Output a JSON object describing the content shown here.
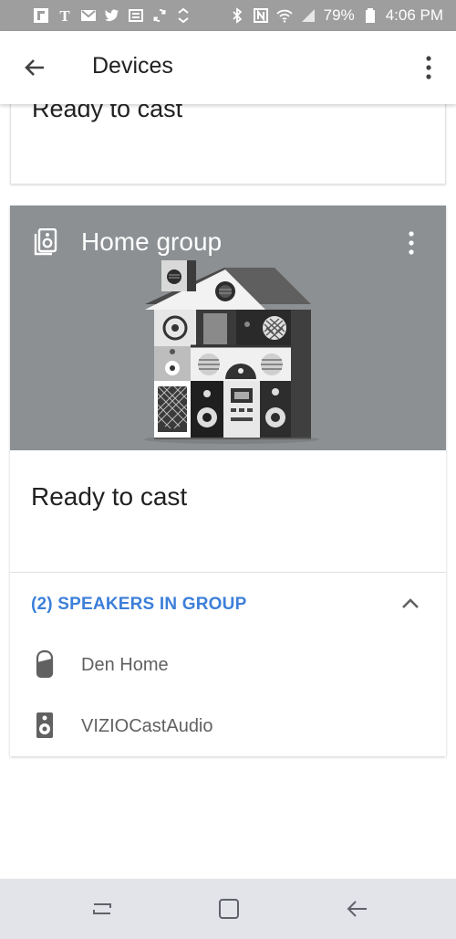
{
  "status_bar": {
    "battery_percent": "79%",
    "time": "4:06 PM",
    "left_icons": [
      "flipboard-icon",
      "nytimes-icon",
      "gmail-icon",
      "twitter-icon",
      "news-icon",
      "sync-icon",
      "data-saver-icon"
    ],
    "right_icons": [
      "bluetooth-icon",
      "nfc-icon",
      "wifi-icon",
      "cell-signal-icon",
      "battery-icon"
    ]
  },
  "app_bar": {
    "title": "Devices",
    "back_icon": "arrow-back-icon",
    "menu_icon": "more-vert-icon"
  },
  "top_card": {
    "status": "Ready to cast"
  },
  "group_card": {
    "name": "Home group",
    "group_icon": "speaker-group-icon",
    "menu_icon": "more-vert-icon",
    "illustration": "speaker-house-illustration",
    "hero_color": "#8c9093",
    "status": "Ready to cast",
    "speakers_header": "(2) SPEAKERS IN GROUP",
    "header_color": "#3d7fd9",
    "expand_icon": "chevron-up-icon",
    "speakers": [
      {
        "name": "Den Home",
        "icon": "google-home-icon"
      },
      {
        "name": "VIZIOCastAudio",
        "icon": "speaker-icon"
      }
    ]
  },
  "nav_bar": {
    "buttons": [
      "recent-apps-icon",
      "home-icon",
      "back-icon"
    ]
  }
}
